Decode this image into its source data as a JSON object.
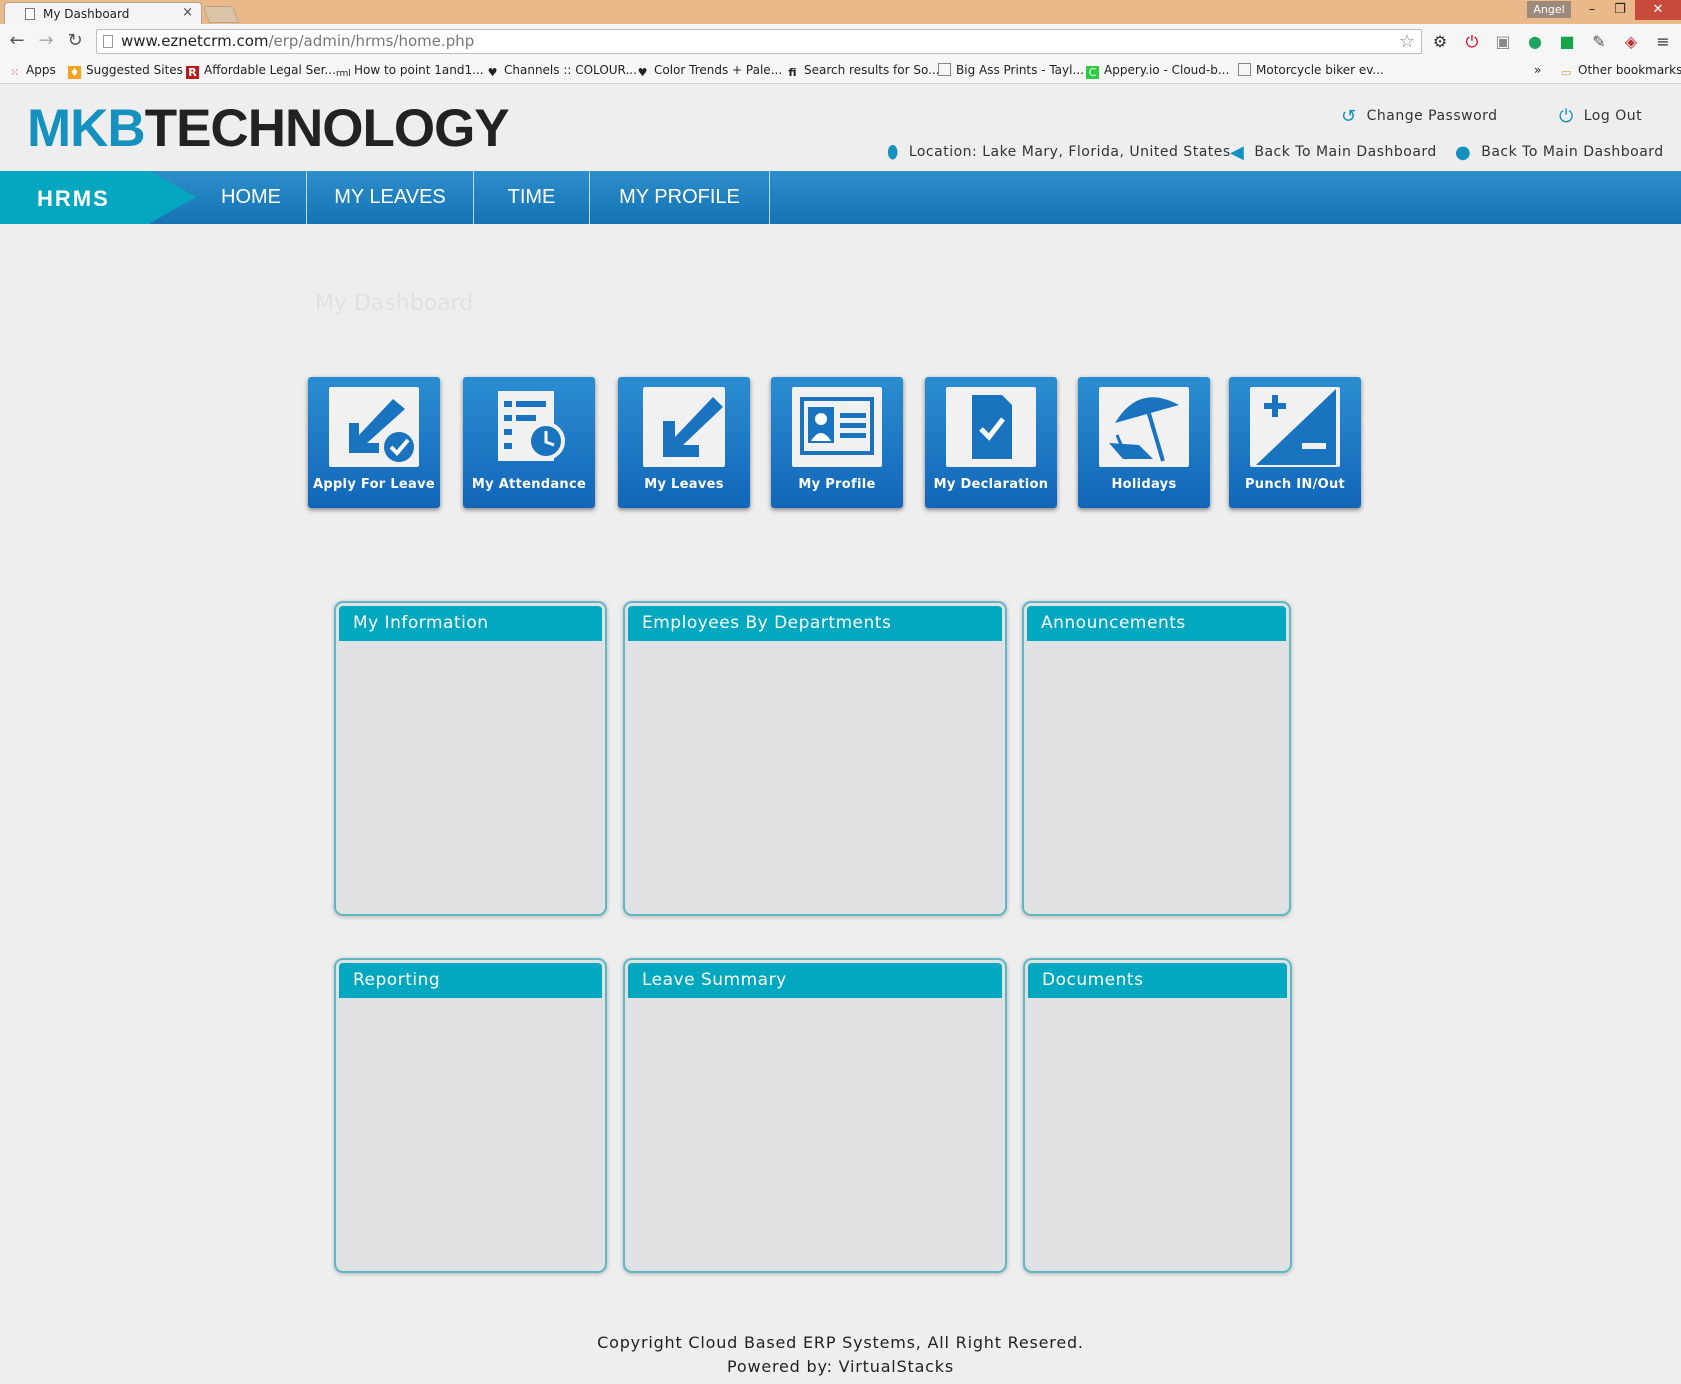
{
  "browser": {
    "tab_title": "My Dashboard",
    "tab_close": "×",
    "user": "Angel",
    "window_min": "–",
    "window_restore": "❐",
    "window_close": "✕",
    "url_host": "www.eznetcrm.com",
    "url_path": "/erp/admin/hrms/home.php",
    "bookmarks": [
      "Apps",
      "Suggested Sites",
      "Affordable Legal Ser...",
      "How to point 1and1...",
      "Channels :: COLOUR...",
      "Color Trends + Pale...",
      "Search results for So...",
      "Big Ass Prints - Tayl...",
      "Appery.io - Cloud-b...",
      "Motorcycle biker ev..."
    ],
    "bookmarks_more": "»",
    "other_bookmarks": "Other bookmarks"
  },
  "header": {
    "logo_part1": "MKB",
    "logo_part2": "TECHNOLOGY",
    "change_password": "Change Password",
    "log_out": "Log Out",
    "location": "Location: Lake Mary, Florida, United States",
    "back_link_1": "Back To Main Dashboard",
    "back_link_2": "Back To Main Dashboard"
  },
  "nav": {
    "module": "HRMS",
    "items": [
      "HOME",
      "MY LEAVES",
      "TIME",
      "MY PROFILE"
    ]
  },
  "main": {
    "page_title": "My Dashboard",
    "tiles": [
      "Apply For Leave",
      "My Attendance",
      "My Leaves",
      "My Profile",
      "My Declaration",
      "Holidays",
      "Punch IN/Out"
    ],
    "panels": [
      "My Information",
      "Employees By Departments",
      "Announcements",
      "Reporting",
      "Leave Summary",
      "Documents"
    ]
  },
  "footer": {
    "copyright": "Copyright Cloud Based ERP Systems, All Right Resered.",
    "powered": "Powered by: VirtualStacks"
  },
  "colors": {
    "brand_blue": "#1591bf",
    "nav_blue": "#1572b3",
    "teal": "#02a7c0"
  }
}
